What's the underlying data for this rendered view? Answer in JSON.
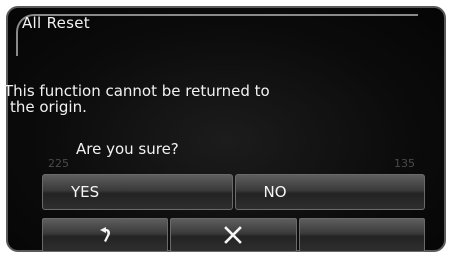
{
  "dialog": {
    "title": "All Reset",
    "message_line1": "This function cannot be returned to",
    "message_line2": "the origin.",
    "question": "Are you sure?"
  },
  "background_scale": {
    "left_value": "225",
    "right_value": "135"
  },
  "buttons": {
    "yes_label": "YES",
    "no_label": "NO"
  },
  "nav": {
    "back_icon": "back-arrow-icon",
    "close_icon": "close-icon"
  }
}
